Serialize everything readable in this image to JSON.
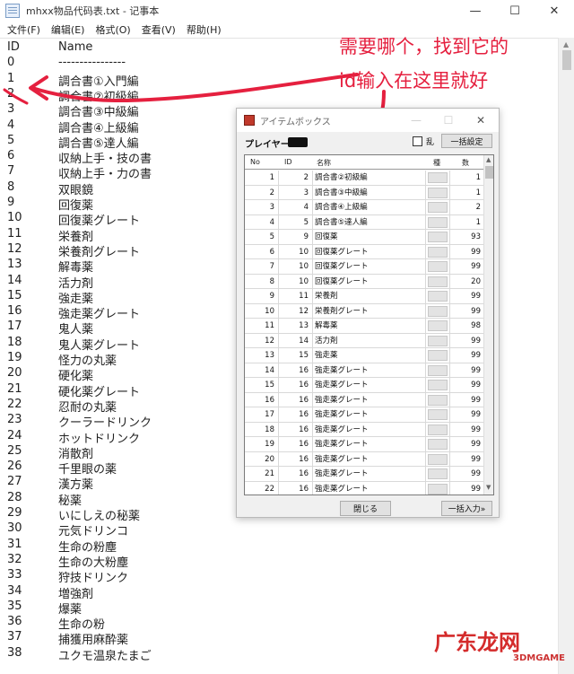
{
  "notepad": {
    "title": "mhxx物品代码表.txt - 记事本",
    "controls": {
      "minimize": "—",
      "maximize": "☐",
      "close": "✕"
    },
    "menus": [
      "文件(F)",
      "编辑(E)",
      "格式(O)",
      "查看(V)",
      "帮助(H)"
    ],
    "header": {
      "id": "ID",
      "name": "Name"
    },
    "separator": {
      "id": "0",
      "name": "----------------"
    },
    "lines": [
      {
        "id": "1",
        "name": "調合書①入門編"
      },
      {
        "id": "2",
        "name": "調合書②初級編"
      },
      {
        "id": "3",
        "name": "調合書③中級編"
      },
      {
        "id": "4",
        "name": "調合書④上級編"
      },
      {
        "id": "5",
        "name": "調合書⑤達人編"
      },
      {
        "id": "6",
        "name": "収納上手・技の書"
      },
      {
        "id": "7",
        "name": "収納上手・力の書"
      },
      {
        "id": "8",
        "name": "双眼鏡"
      },
      {
        "id": "9",
        "name": "回復薬"
      },
      {
        "id": "10",
        "name": "回復薬グレート"
      },
      {
        "id": "11",
        "name": "栄養剤"
      },
      {
        "id": "12",
        "name": "栄養剤グレート"
      },
      {
        "id": "13",
        "name": "解毒薬"
      },
      {
        "id": "14",
        "name": "活力剤"
      },
      {
        "id": "15",
        "name": "強走薬"
      },
      {
        "id": "16",
        "name": "強走薬グレート"
      },
      {
        "id": "17",
        "name": "鬼人薬"
      },
      {
        "id": "18",
        "name": "鬼人薬グレート"
      },
      {
        "id": "19",
        "name": "怪力の丸薬"
      },
      {
        "id": "20",
        "name": "硬化薬"
      },
      {
        "id": "21",
        "name": "硬化薬グレート"
      },
      {
        "id": "22",
        "name": "忍耐の丸薬"
      },
      {
        "id": "23",
        "name": "クーラードリンク"
      },
      {
        "id": "24",
        "name": "ホットドリンク"
      },
      {
        "id": "25",
        "name": "消散剤"
      },
      {
        "id": "26",
        "name": "千里眼の薬"
      },
      {
        "id": "27",
        "name": "漢方薬"
      },
      {
        "id": "28",
        "name": "秘薬"
      },
      {
        "id": "29",
        "name": "いにしえの秘薬"
      },
      {
        "id": "30",
        "name": "元気ドリンコ"
      },
      {
        "id": "31",
        "name": "生命の粉塵"
      },
      {
        "id": "32",
        "name": "生命の大粉塵"
      },
      {
        "id": "33",
        "name": "狩技ドリンク"
      },
      {
        "id": "34",
        "name": "増強剤"
      },
      {
        "id": "35",
        "name": "爆薬"
      },
      {
        "id": "36",
        "name": "生命の粉"
      },
      {
        "id": "37",
        "name": "捕獲用麻酔薬"
      },
      {
        "id": "38",
        "name": "ユクモ温泉たまご"
      }
    ]
  },
  "annotation": {
    "line1": "需要哪个，找到它的",
    "line2": "id输入在这里就好",
    "color": "#e5203f"
  },
  "itembox": {
    "title": "アイテムボックス",
    "controls": {
      "minimize": "—",
      "maximize": "☐",
      "close": "✕"
    },
    "player_label": "プレイヤー:",
    "random_label": "乱",
    "bulk_set_button": "一括設定",
    "close_button": "閉じる",
    "bulk_input_button": "一括入力»",
    "columns": {
      "no": "No",
      "id": "ID",
      "name": "名称",
      "kind": "種",
      "qty": "数"
    },
    "rows": [
      {
        "no": "1",
        "id": "2",
        "name": "調合書②初級編",
        "qty": "1"
      },
      {
        "no": "2",
        "id": "3",
        "name": "調合書③中級編",
        "qty": "1"
      },
      {
        "no": "3",
        "id": "4",
        "name": "調合書④上級編",
        "qty": "2"
      },
      {
        "no": "4",
        "id": "5",
        "name": "調合書⑤達人編",
        "qty": "1"
      },
      {
        "no": "5",
        "id": "9",
        "name": "回復薬",
        "qty": "93"
      },
      {
        "no": "6",
        "id": "10",
        "name": "回復薬グレート",
        "qty": "99"
      },
      {
        "no": "7",
        "id": "10",
        "name": "回復薬グレート",
        "qty": "99"
      },
      {
        "no": "8",
        "id": "10",
        "name": "回復薬グレート",
        "qty": "20"
      },
      {
        "no": "9",
        "id": "11",
        "name": "栄養剤",
        "qty": "99"
      },
      {
        "no": "10",
        "id": "12",
        "name": "栄養剤グレート",
        "qty": "99"
      },
      {
        "no": "11",
        "id": "13",
        "name": "解毒薬",
        "qty": "98"
      },
      {
        "no": "12",
        "id": "14",
        "name": "活力剤",
        "qty": "99"
      },
      {
        "no": "13",
        "id": "15",
        "name": "強走薬",
        "qty": "99"
      },
      {
        "no": "14",
        "id": "16",
        "name": "強走薬グレート",
        "qty": "99"
      },
      {
        "no": "15",
        "id": "16",
        "name": "強走薬グレート",
        "qty": "99"
      },
      {
        "no": "16",
        "id": "16",
        "name": "強走薬グレート",
        "qty": "99"
      },
      {
        "no": "17",
        "id": "16",
        "name": "強走薬グレート",
        "qty": "99"
      },
      {
        "no": "18",
        "id": "16",
        "name": "強走薬グレート",
        "qty": "99"
      },
      {
        "no": "19",
        "id": "16",
        "name": "強走薬グレート",
        "qty": "99"
      },
      {
        "no": "20",
        "id": "16",
        "name": "強走薬グレート",
        "qty": "99"
      },
      {
        "no": "21",
        "id": "16",
        "name": "強走薬グレート",
        "qty": "99"
      },
      {
        "no": "22",
        "id": "16",
        "name": "強走薬グレート",
        "qty": "99"
      }
    ]
  },
  "watermark": {
    "main": "广东龙网",
    "sub": "3DMGAME"
  }
}
